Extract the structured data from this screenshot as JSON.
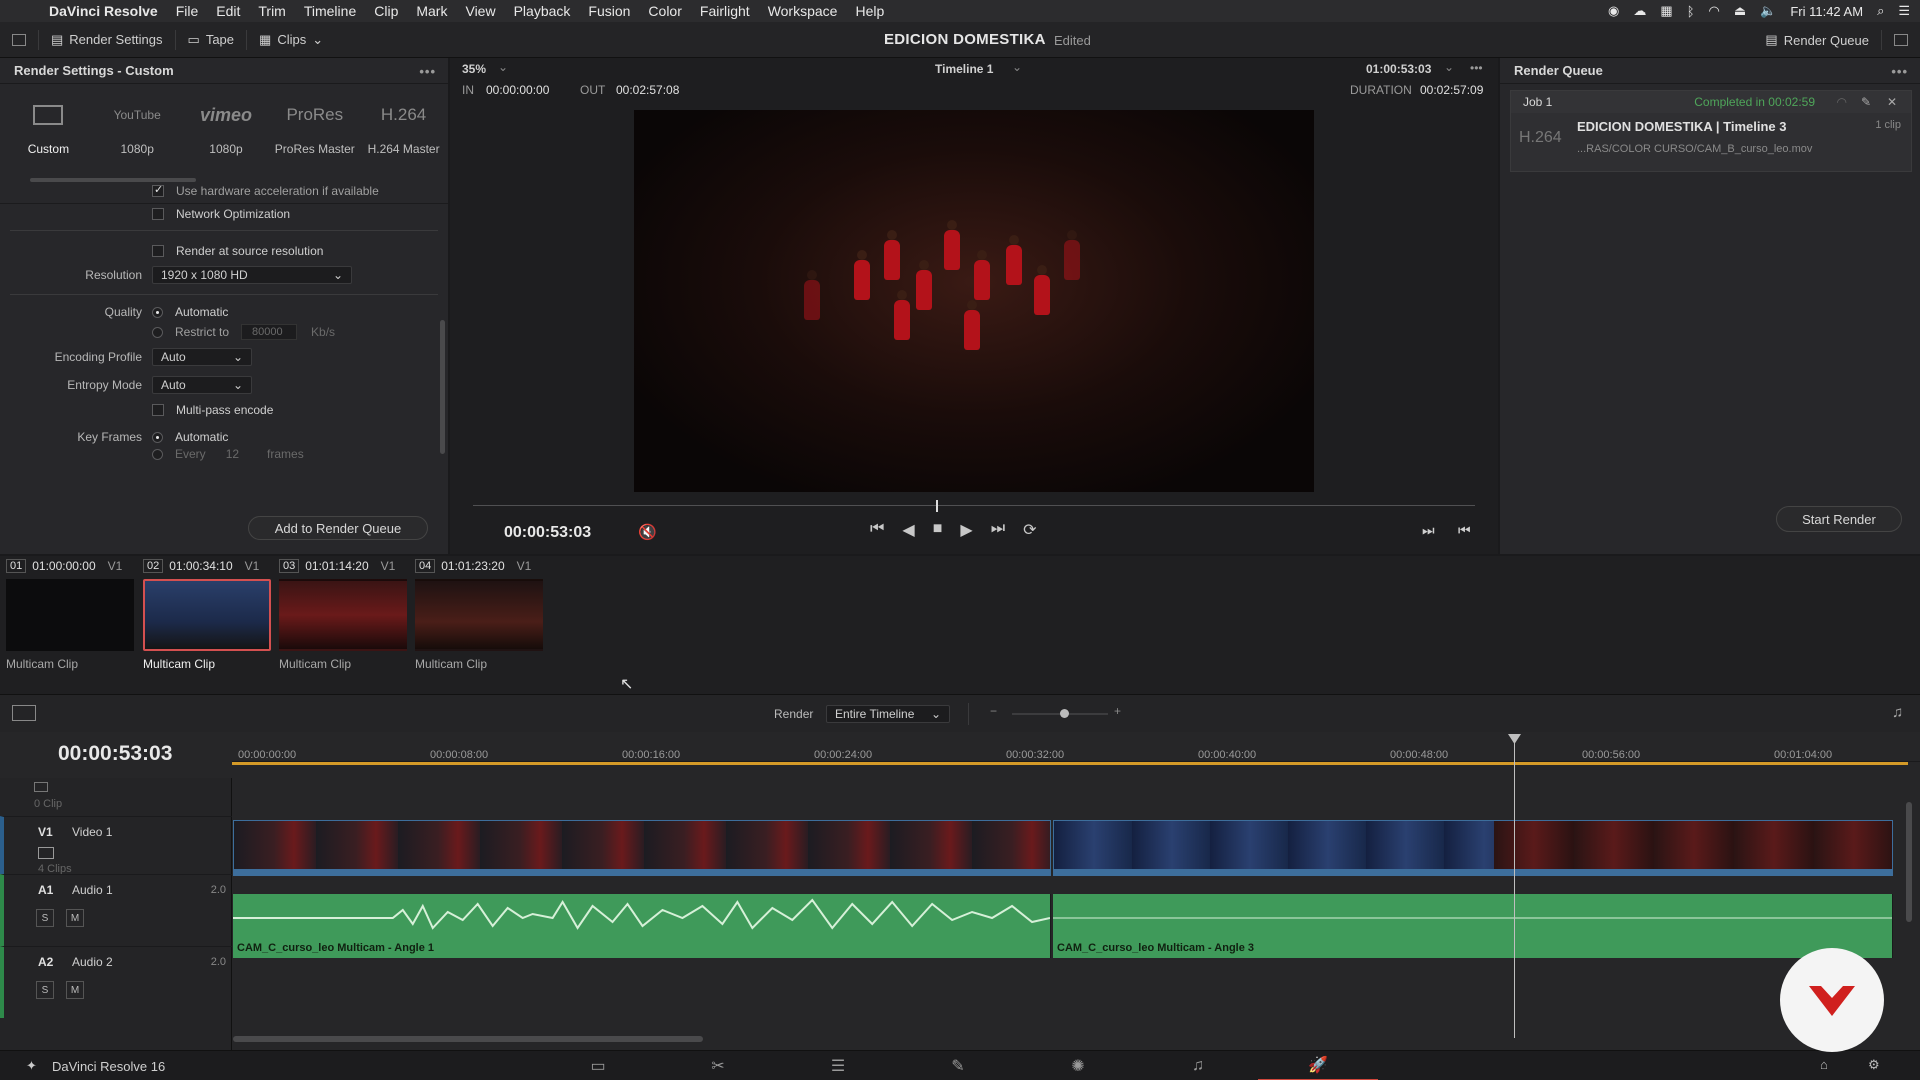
{
  "menubar": {
    "app_name": "DaVinci Resolve",
    "items": [
      "File",
      "Edit",
      "Trim",
      "Timeline",
      "Clip",
      "Mark",
      "View",
      "Playback",
      "Fusion",
      "Color",
      "Fairlight",
      "Workspace",
      "Help"
    ],
    "clock": "Fri 11:42 AM"
  },
  "toolbar": {
    "render_settings": "Render Settings",
    "tape": "Tape",
    "clips": "Clips",
    "project_title": "EDICION DOMESTIKA",
    "project_status": "Edited",
    "render_queue": "Render Queue"
  },
  "render_settings": {
    "title": "Render Settings - Custom",
    "presets": [
      {
        "logo": "",
        "label": "Custom"
      },
      {
        "logo": "YouTube",
        "label": "1080p"
      },
      {
        "logo": "vimeo",
        "label": "1080p"
      },
      {
        "logo": "ProRes",
        "label": "ProRes Master"
      },
      {
        "logo": "H.264",
        "label": "H.264 Master"
      }
    ],
    "hw_accel": "Use hardware acceleration if available",
    "network_opt": "Network Optimization",
    "source_res": "Render at source resolution",
    "resolution_label": "Resolution",
    "resolution_value": "1920 x 1080 HD",
    "quality_label": "Quality",
    "quality_auto": "Automatic",
    "restrict_to": "Restrict to",
    "restrict_value": "80000",
    "restrict_unit": "Kb/s",
    "encoding_label": "Encoding Profile",
    "encoding_value": "Auto",
    "entropy_label": "Entropy Mode",
    "entropy_value": "Auto",
    "multipass": "Multi-pass encode",
    "keyframes_label": "Key Frames",
    "keyframes_auto": "Automatic",
    "every": "Every",
    "every_value": "12",
    "frames": "frames",
    "add_button": "Add to Render Queue"
  },
  "viewer": {
    "zoom": "35%",
    "timeline_name": "Timeline 1",
    "timecode_top": "01:00:53:03",
    "in_label": "IN",
    "in_value": "00:00:00:00",
    "out_label": "OUT",
    "out_value": "00:02:57:08",
    "duration_label": "DURATION",
    "duration_value": "00:02:57:09",
    "current_tc": "00:00:53:03"
  },
  "render_queue": {
    "title": "Render Queue",
    "job_name": "Job 1",
    "job_status": "Completed in 00:02:59",
    "job_codec": "H.264",
    "job_title": "EDICION DOMESTIKA | Timeline 3",
    "job_clips": "1 clip",
    "job_path": "...RAS/COLOR CURSO/CAM_B_curso_leo.mov",
    "start_button": "Start Render"
  },
  "clips": [
    {
      "num": "01",
      "tc": "01:00:00:00",
      "track": "V1",
      "label": "Multicam Clip"
    },
    {
      "num": "02",
      "tc": "01:00:34:10",
      "track": "V1",
      "label": "Multicam Clip"
    },
    {
      "num": "03",
      "tc": "01:01:14:20",
      "track": "V1",
      "label": "Multicam Clip"
    },
    {
      "num": "04",
      "tc": "01:01:23:20",
      "track": "V1",
      "label": "Multicam Clip"
    }
  ],
  "timeline_bar": {
    "render_label": "Render",
    "render_value": "Entire Timeline"
  },
  "timeline": {
    "timecode": "00:00:53:03",
    "ruler": [
      "00:00:00:00",
      "00:00:08:00",
      "00:00:16:00",
      "00:00:24:00",
      "00:00:32:00",
      "00:00:40:00",
      "00:00:48:00",
      "00:00:56:00",
      "00:01:04:00"
    ],
    "empty_track_count": "0 Clip",
    "v1_label": "V1",
    "v1_name": "Video 1",
    "v1_count": "4 Clips",
    "a1_label": "A1",
    "a1_name": "Audio 1",
    "a1_level": "2.0",
    "a2_label": "A2",
    "a2_name": "Audio 2",
    "a2_level": "2.0",
    "solo": "S",
    "mute": "M",
    "audio_clip_1": "CAM_C_curso_leo Multicam - Angle 1",
    "audio_clip_2": "CAM_C_curso_leo Multicam - Angle 3"
  },
  "footer": {
    "app_version": "DaVinci Resolve 16"
  }
}
